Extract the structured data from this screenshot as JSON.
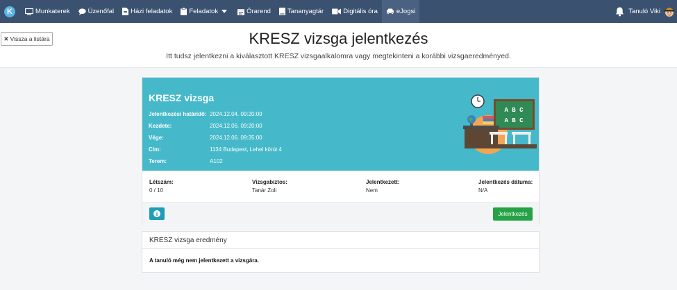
{
  "nav": {
    "items": [
      {
        "label": "Munkaterek",
        "icon": "monitor-icon"
      },
      {
        "label": "Üzenőfal",
        "icon": "chat-bubble-icon"
      },
      {
        "label": "Házi feladatok",
        "icon": "document-icon"
      },
      {
        "label": "Feladatok",
        "icon": "clipboard-icon"
      },
      {
        "label": "Órarend",
        "icon": "calendar-icon"
      },
      {
        "label": "Tananyagtár",
        "icon": "book-icon"
      },
      {
        "label": "Digitális óra",
        "icon": "video-camera-icon"
      },
      {
        "label": "eJogsi",
        "icon": "car-icon"
      }
    ],
    "user_name": "Tanuló Viki",
    "active": "eJogsi"
  },
  "header": {
    "back_label": "Vissza a listára",
    "title": "KRESZ vizsga jelentkezés",
    "subtitle": "Itt tudsz jelentkezni a kiválasztott KRESZ vizsgaalkalomra vagy megtekinteni a korábbi vizsgaeredményed."
  },
  "exam": {
    "title": "KRESZ vizsga",
    "deadline_label": "Jelentkezési határidő:",
    "deadline_value": "2024.12.04. 09:20:00",
    "start_label": "Kezdete:",
    "start_value": "2024.12.06. 09:20:00",
    "end_label": "Vége:",
    "end_value": "2024.12.06. 09:35:00",
    "address_label": "Cím:",
    "address_value": "1134 Budapest, Lehel körút 4",
    "room_label": "Terem:",
    "room_value": "A102",
    "board_line1": "A B C",
    "board_line2": "A B C"
  },
  "stats": {
    "capacity_label": "Létszám:",
    "capacity_value": "0 / 10",
    "examiner_label": "Vizsgabiztos:",
    "examiner_value": "Tanár Zoli",
    "registered_label": "Jelentkezett:",
    "registered_value": "Nem",
    "reg_date_label": "Jelentkezés dátuma:",
    "reg_date_value": "N/A"
  },
  "actions": {
    "apply_label": "Jelentkezés"
  },
  "result": {
    "title": "KRESZ vizsga eredmény",
    "text": "A tanuló még nem jelentkezett a vizsgára."
  },
  "colors": {
    "navbar": "#3b5170",
    "card_header": "#45b9c9",
    "apply_button": "#25a245",
    "info_button": "#1f9db7"
  }
}
